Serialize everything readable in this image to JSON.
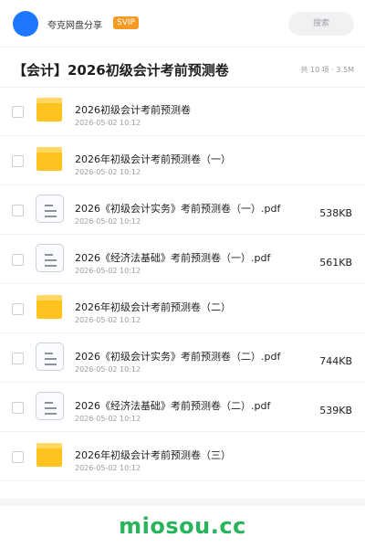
{
  "header": {
    "brand": "夸克网盘分享",
    "badge": "SVIP",
    "search_placeholder": "搜索"
  },
  "folder": {
    "title": "【会计】2026初级会计考前预测卷",
    "summary": "共 10 项 · 3.5M"
  },
  "files": [
    {
      "name": "2026初级会计考前预测卷",
      "date": "2026-05-02 10:12",
      "size": "",
      "type": "folder"
    },
    {
      "name": "2026年初级会计考前预测卷（一）",
      "date": "2026-05-02 10:12",
      "size": "",
      "type": "folder"
    },
    {
      "name": "2026《初级会计实务》考前预测卷（一）.pdf",
      "date": "2026-05-02 10:12",
      "size": "538KB",
      "type": "pdf"
    },
    {
      "name": "2026《经济法基础》考前预测卷（一）.pdf",
      "date": "2026-05-02 10:12",
      "size": "561KB",
      "type": "pdf"
    },
    {
      "name": "2026年初级会计考前预测卷（二）",
      "date": "2026-05-02 10:12",
      "size": "",
      "type": "folder"
    },
    {
      "name": "2026《初级会计实务》考前预测卷（二）.pdf",
      "date": "2026-05-02 10:12",
      "size": "744KB",
      "type": "pdf"
    },
    {
      "name": "2026《经济法基础》考前预测卷（二）.pdf",
      "date": "2026-05-02 10:12",
      "size": "539KB",
      "type": "pdf"
    },
    {
      "name": "2026年初级会计考前预测卷（三）",
      "date": "2026-05-02 10:12",
      "size": "",
      "type": "folder"
    }
  ],
  "watermark": "miosou.cc",
  "colors": {
    "avatar": "#1e77ff",
    "badge": "#f59a23",
    "folder": "#ffc31f",
    "watermark": "#27b45a"
  }
}
